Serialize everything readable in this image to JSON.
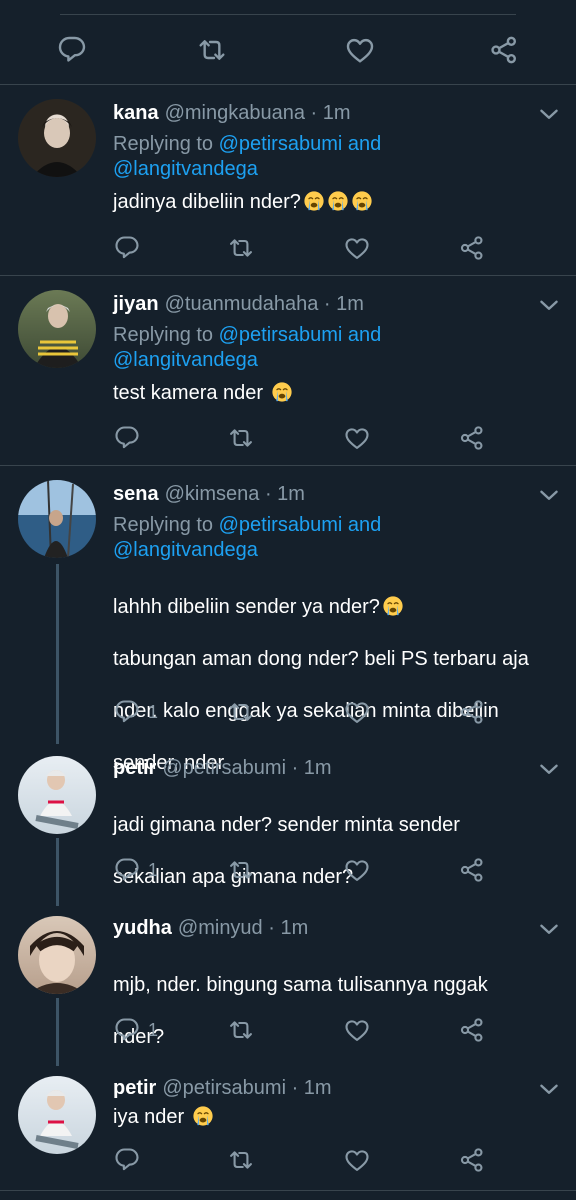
{
  "colors": {
    "background": "#15202b",
    "divider": "#38444d",
    "muted": "#8899a6",
    "link": "#1da1f2",
    "text": "#ffffff"
  },
  "icons": {
    "reply": "reply-icon",
    "retweet": "retweet-icon",
    "like": "like-icon",
    "share": "share-icon",
    "more": "chevron-down-icon"
  },
  "replying_prefix": "Replying to",
  "replying_and": "and",
  "tweets": [
    {
      "name": "kana",
      "handle": "@mingkabuana",
      "time": "· 1m",
      "reply_to": [
        "@petirsabumi",
        "@langitvandega"
      ],
      "text": "jadinya dibeliin nder?",
      "emoji_count": 3,
      "reply_count": ""
    },
    {
      "name": "jiyan",
      "handle": "@tuanmudahaha",
      "time": "· 1m",
      "reply_to": [
        "@petirsabumi",
        "@langitvandega"
      ],
      "text": "test kamera nder",
      "emoji_count": 1,
      "reply_count": ""
    },
    {
      "name": "sena",
      "handle": "@kimsena",
      "time": "· 1m",
      "reply_to": [
        "@petirsabumi",
        "@langitvandega"
      ],
      "text_lines": [
        "lahhh dibeliin sender ya nder?",
        "tabungan aman dong nder? beli PS terbaru aja",
        "nder. kalo enggak ya sekalian minta dibeliin",
        "sender, nder"
      ],
      "emoji_count": 1,
      "reply_count": "1"
    },
    {
      "name": "petir",
      "handle": "@petirsabumi",
      "time": "· 1m",
      "text_lines": [
        "jadi gimana nder? sender minta sender",
        "sekalian apa gimana nder?"
      ],
      "reply_count": "1"
    },
    {
      "name": "yudha",
      "handle": "@minyud",
      "time": "· 1m",
      "text_lines": [
        "mjb, nder. bingung sama tulisannya nggak",
        "nder?"
      ],
      "reply_count": "1"
    },
    {
      "name": "petir",
      "handle": "@petirsabumi",
      "time": "· 1m",
      "text": "iya nder",
      "emoji_count": 1,
      "reply_count": ""
    }
  ]
}
